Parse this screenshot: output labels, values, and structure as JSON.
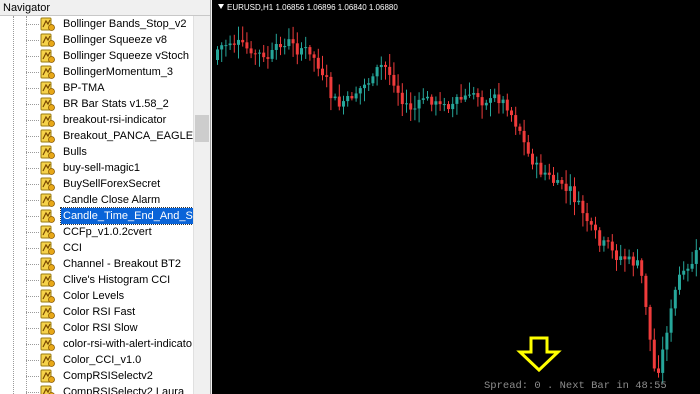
{
  "navigator": {
    "title": "Navigator",
    "items": [
      {
        "label": "Bollinger Bands_Stop_v2",
        "selected": false
      },
      {
        "label": "Bollinger Squeeze v8",
        "selected": false
      },
      {
        "label": "Bollinger Squeeze vStoch",
        "selected": false
      },
      {
        "label": "BollingerMomentum_3",
        "selected": false
      },
      {
        "label": "BP-TMA",
        "selected": false
      },
      {
        "label": "BR Bar Stats v1.58_2",
        "selected": false
      },
      {
        "label": "breakout-rsi-indicator",
        "selected": false
      },
      {
        "label": "Breakout_PANCA_EAGLE",
        "selected": false
      },
      {
        "label": "Bulls",
        "selected": false
      },
      {
        "label": "buy-sell-magic1",
        "selected": false
      },
      {
        "label": "BuySellForexSecret",
        "selected": false
      },
      {
        "label": "Candle Close Alarm",
        "selected": false
      },
      {
        "label": "Candle_Time_End_And_Spre",
        "selected": true
      },
      {
        "label": "CCFp_v1.0.2cvert",
        "selected": false
      },
      {
        "label": "CCI",
        "selected": false
      },
      {
        "label": "Channel - Breakout BT2",
        "selected": false
      },
      {
        "label": "Clive's Histogram CCI",
        "selected": false
      },
      {
        "label": "Color Levels",
        "selected": false
      },
      {
        "label": "Color RSI Fast",
        "selected": false
      },
      {
        "label": "Color RSI Slow",
        "selected": false
      },
      {
        "label": "color-rsi-with-alert-indicato",
        "selected": false
      },
      {
        "label": "Color_CCI_v1.0",
        "selected": false
      },
      {
        "label": "CompRSISelectv2",
        "selected": false
      },
      {
        "label": "CompRSISelectv2 Laura",
        "selected": false
      }
    ],
    "item_icon": "custom-indicator-icon"
  },
  "chart": {
    "title": "EURUSD,H1  1.06856 1.06896 1.06840 1.06880",
    "status_text": "Spread: 0 . Next Bar in 48:55",
    "arrow_icon": "yellow-down-arrow-icon",
    "colors": {
      "bull": "#26a69a",
      "bear": "#ef3b3b",
      "background": "#000000",
      "arrow": "#ffff00"
    }
  }
}
